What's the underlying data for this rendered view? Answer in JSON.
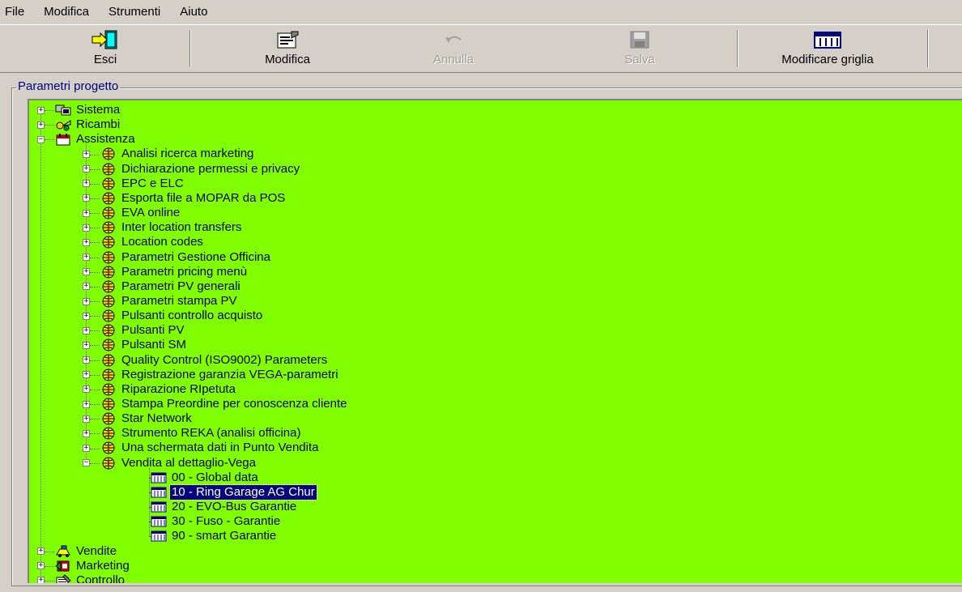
{
  "menu": [
    "File",
    "Modifica",
    "Strumenti",
    "Aiuto"
  ],
  "toolbar": {
    "esci": "Esci",
    "modifica": "Modifica",
    "annulla": "Annulla",
    "salva": "Salva",
    "modificare_griglia": "Modificare griglia"
  },
  "group_title": "Parametri progetto",
  "tree": {
    "top": [
      "Sistema",
      "Ricambi",
      "Assistenza"
    ],
    "assistenza_children": [
      "Analisi ricerca marketing",
      "Dichiarazione permessi e privacy",
      "EPC e ELC",
      "Esporta file a MOPAR da POS",
      "EVA online",
      "Inter location transfers",
      "Location codes",
      "Parametri Gestione Officina",
      "Parametri pricing menù",
      "Parametri PV generali",
      "Parametri stampa PV",
      "Pulsanti controllo acquisto",
      "Pulsanti PV",
      "Pulsanti SM",
      "Quality Control (ISO9002) Parameters",
      "Registrazione garanzia VEGA-parametri",
      "Riparazione RIpetuta",
      "Stampa Preordine per conoscenza cliente",
      "Star Network",
      "Strumento REKA (analisi officina)",
      "Una schermata dati in Punto Vendita",
      "Vendita al dettaglio-Vega"
    ],
    "vega_children": [
      "00 - Global data",
      "10 - Ring Garage AG Chur",
      "20 - EVO-Bus Garantie",
      "30 - Fuso - Garantie",
      "90 - smart Garantie"
    ],
    "bottom": [
      "Vendite",
      "Marketing",
      "Controllo"
    ],
    "selected": "10 - Ring Garage AG Chur"
  },
  "colors": {
    "tree_background": "#80ff00",
    "selection": "#000080",
    "chrome": "#d4d0c8"
  }
}
